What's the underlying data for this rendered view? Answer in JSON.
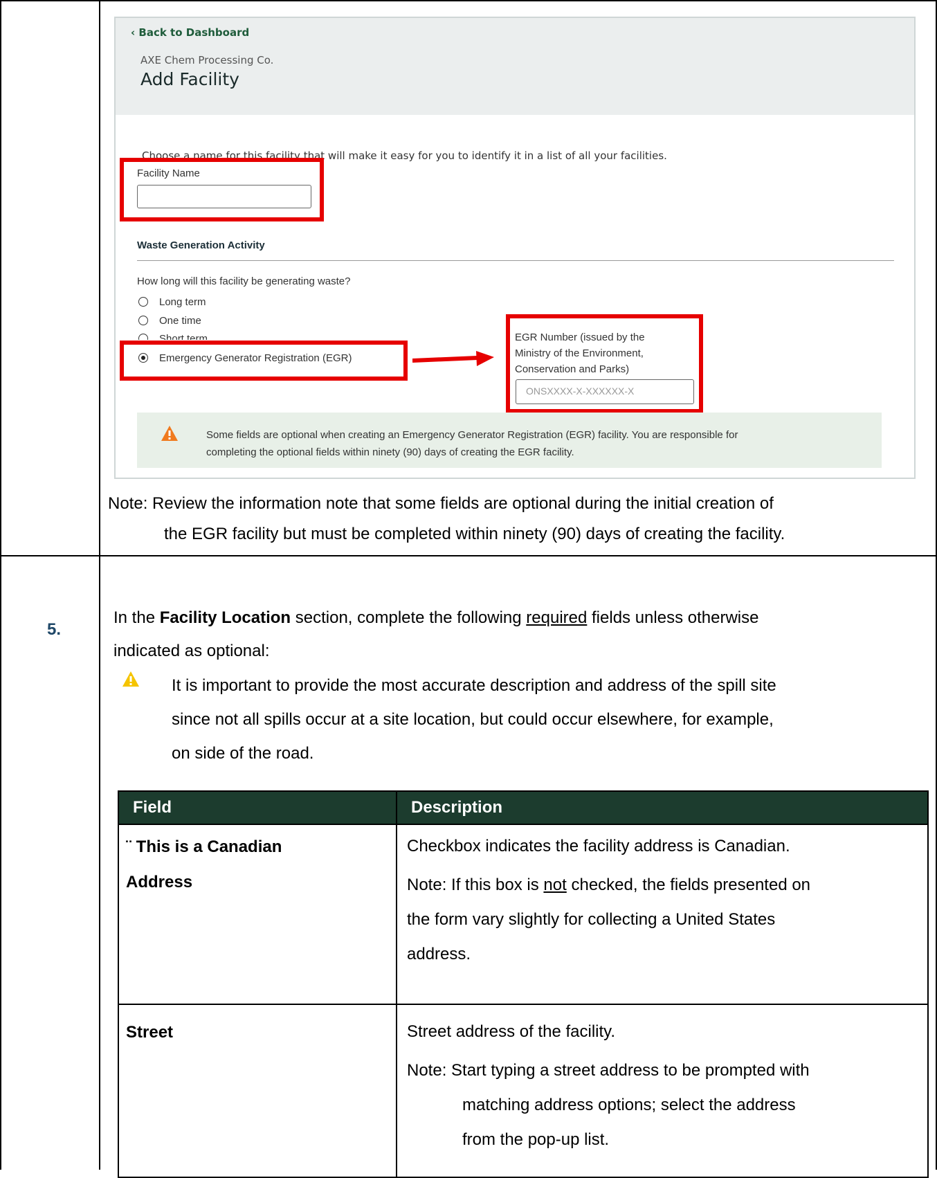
{
  "screenshot": {
    "back_link": "‹ Back to Dashboard",
    "company": "AXE Chem Processing Co.",
    "title": "Add Facility",
    "intro": "Choose a name for this facility that will make it easy for you to identify it in a list of all your facilities.",
    "facility_name_label": "Facility Name",
    "section_title": "Waste Generation Activity",
    "question": "How long will this facility be generating waste?",
    "options": [
      "Long term",
      "One time",
      "Short term",
      "Emergency Generator Registration (EGR)"
    ],
    "selected_option": "Emergency Generator Registration (EGR)",
    "egr_label_1": "EGR Number (issued by the",
    "egr_label_2": "Ministry of the Environment,",
    "egr_label_3": "Conservation and Parks)",
    "egr_placeholder": "ONSXXXX-X-XXXXXX-X",
    "notice_1": "Some fields are optional when creating an Emergency Generator Registration (EGR) facility. You are responsible for",
    "notice_2": "completing the optional fields within ninety (90) days of creating the EGR facility.",
    "highlight_color": "#e60000"
  },
  "note": {
    "line1": "Note: Review the information note that some fields are optional during the initial creation of",
    "line2": "the EGR facility but must be completed within ninety (90) days of creating the facility."
  },
  "step": {
    "number": "5.",
    "intro_pre": "In the ",
    "intro_bold": "Facility Location",
    "intro_mid": " section, complete the following ",
    "intro_underline": "required",
    "intro_post": " fields unless otherwise",
    "intro_line2": "indicated as optional:",
    "warning_1": "It is important to provide the most accurate description and address of the spill site",
    "warning_2": "since not all spills occur at a site location, but could occur elsewhere, for example,",
    "warning_3": "on side of the road."
  },
  "table": {
    "headers": [
      "Field",
      "Description"
    ],
    "header_color": "#1c3c2e",
    "rows": [
      {
        "field_1": "¨ This is a Canadian",
        "field_2": "Address",
        "desc": "Checkbox indicates the facility address is Canadian.",
        "note_pre": "Note: If this box is ",
        "note_underline": "not",
        "note_post": " checked, the fields presented on",
        "note_2": "the form vary slightly for collecting a United States",
        "note_3": "address."
      },
      {
        "field_1": "Street",
        "desc": "Street address of the facility.",
        "note_1": "Note: Start typing a street address to be prompted with",
        "note_2": "matching address options; select the address",
        "note_3": "from the pop-up list."
      }
    ]
  }
}
